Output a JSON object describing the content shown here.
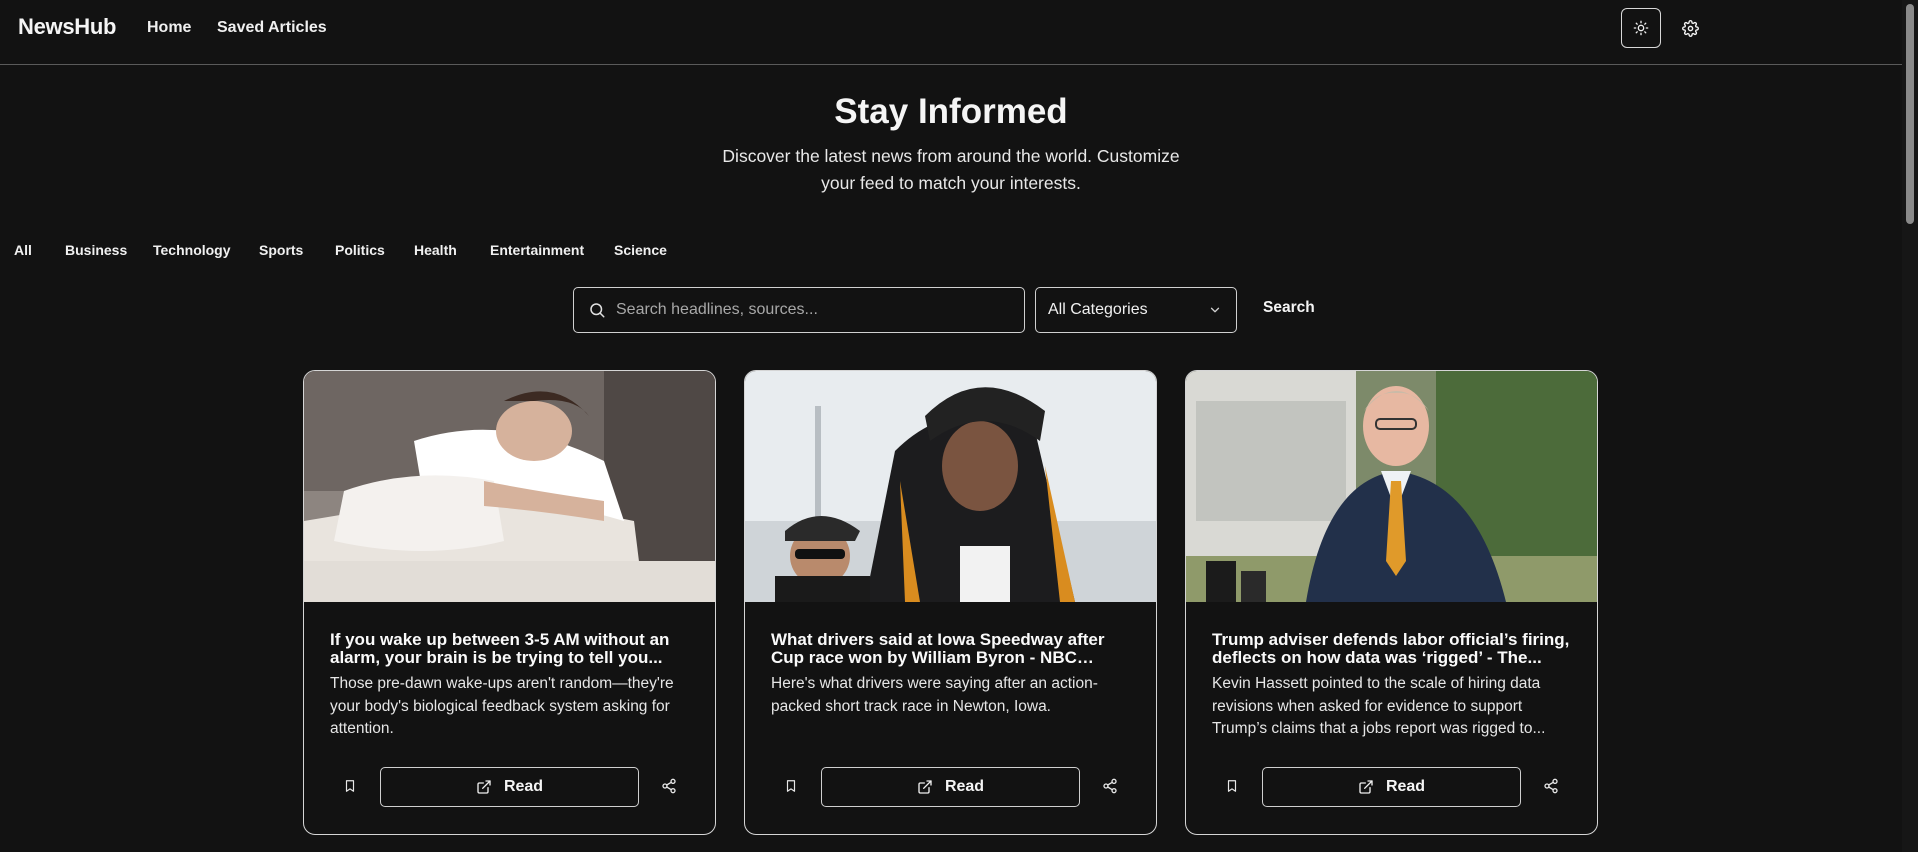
{
  "header": {
    "brand": "NewsHub",
    "nav": [
      {
        "label": "Home"
      },
      {
        "label": "Saved Articles"
      }
    ],
    "theme_icon": "sun-icon",
    "settings_icon": "gear-icon"
  },
  "hero": {
    "title": "Stay Informed",
    "subtitle": "Discover the latest news from around the world. Customize your feed to match your interests."
  },
  "categories": [
    "All",
    "Business",
    "Technology",
    "Sports",
    "Politics",
    "Health",
    "Entertainment",
    "Science"
  ],
  "search": {
    "placeholder": "Search headlines, sources...",
    "value": "",
    "category_selected": "All Categories",
    "button_label": "Search"
  },
  "articles": [
    {
      "title": "If you wake up between 3-5 AM without an alarm, your brain is be trying to tell you...",
      "description": "Those pre-dawn wake-ups aren't random—they're your body's biological feedback system asking for attention.",
      "image_subject": "woman-sleeping-in-bed",
      "read_label": "Read"
    },
    {
      "title": "What drivers said at Iowa Speedway after Cup race won by William Byron - NBC Sports",
      "description": "Here's what drivers were saying after an action-packed short track race in Newton, Iowa.",
      "image_subject": "race-driver-removing-helmet",
      "read_label": "Read"
    },
    {
      "title": "Trump adviser defends labor official’s firing, deflects on how data was ‘rigged’ - The...",
      "description": "Kevin Hassett pointed to the scale of hiring data revisions when asked for evidence to support Trump’s claims that a jobs report was rigged to...",
      "image_subject": "man-in-suit-speaking-outdoors",
      "read_label": "Read"
    }
  ],
  "colors": {
    "background": "#121212",
    "text": "#f5f5f5",
    "border": "#d5d5d5"
  }
}
